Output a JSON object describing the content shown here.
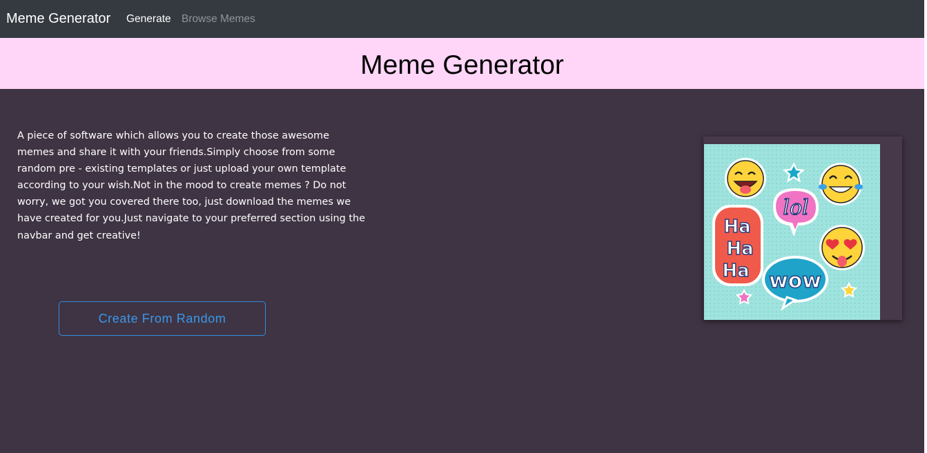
{
  "navbar": {
    "brand": "Meme Generator",
    "links": [
      {
        "label": "Generate",
        "active": true
      },
      {
        "label": "Browse Memes",
        "active": false
      }
    ]
  },
  "hero": {
    "title": "Meme Generator"
  },
  "main": {
    "description": "A piece of software which allows you to create those awesome memes and share it with your friends.Simply choose from some random pre - existing templates or just upload your own template according to your wish.Not in the mood to create memes ? Do not worry, we got you covered there too, just download the memes we have created for you.Just navigate to your preferred section using the navbar and get creative!",
    "create_button_label": "Create From Random"
  },
  "illustration": {
    "stickers": [
      "Ha",
      "Ha",
      "Ha",
      "lol",
      "wow"
    ]
  },
  "colors": {
    "navbar_bg": "#343a40",
    "hero_bg": "#ffd6f8",
    "page_bg": "#3f3443",
    "accent": "#3a98ea",
    "image_bg": "#9fe3de"
  }
}
